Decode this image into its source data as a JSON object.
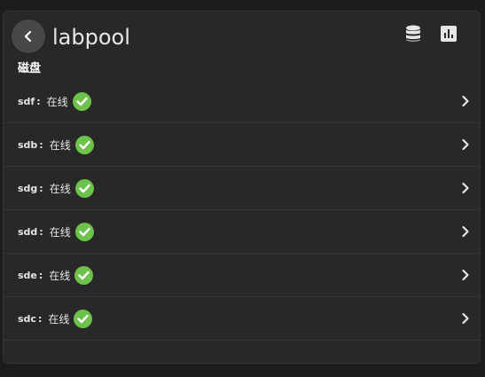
{
  "header": {
    "title": "labpool",
    "back_icon": "chevron-left-icon",
    "actions": [
      {
        "name": "database-icon"
      },
      {
        "name": "bar-chart-icon"
      }
    ]
  },
  "section": {
    "label": "磁盘"
  },
  "disks": [
    {
      "name": "sdf",
      "separator": ":",
      "status": "在线"
    },
    {
      "name": "sdb",
      "separator": ":",
      "status": "在线"
    },
    {
      "name": "sdg",
      "separator": ":",
      "status": "在线"
    },
    {
      "name": "sdd",
      "separator": ":",
      "status": "在线"
    },
    {
      "name": "sde",
      "separator": ":",
      "status": "在线"
    },
    {
      "name": "sdc",
      "separator": ":",
      "status": "在线"
    }
  ],
  "colors": {
    "background": "#1c1c1c",
    "card": "#282828",
    "online": "#6cc24a",
    "text": "#e6e6e6"
  }
}
